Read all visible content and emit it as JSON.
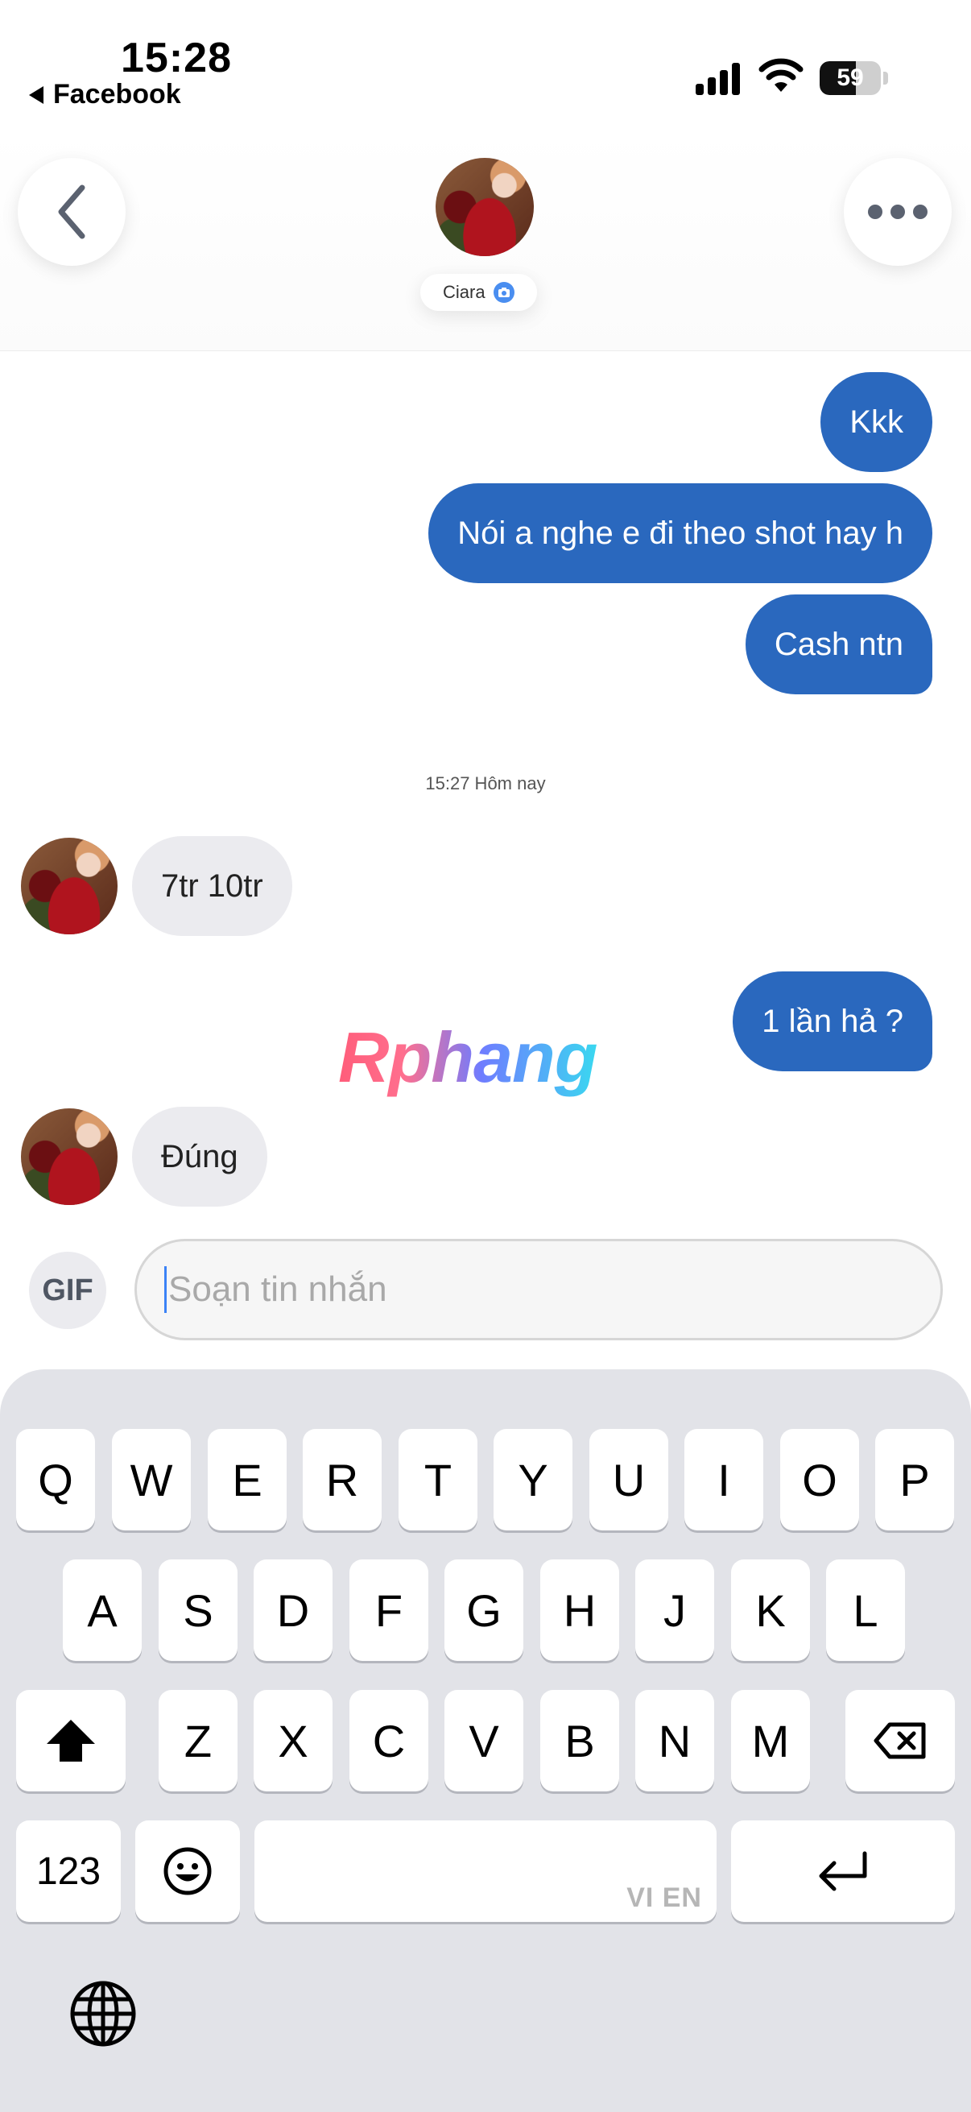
{
  "status_bar": {
    "time": "15:28",
    "back_app": "Facebook",
    "battery": "59",
    "battery_level": 0.59
  },
  "header": {
    "contact_name": "Ciara"
  },
  "messages": [
    {
      "text": "Kkk",
      "direction": "outgoing"
    },
    {
      "text": "Nói a nghe e đi theo shot hay h",
      "direction": "outgoing"
    },
    {
      "text": "Cash ntn",
      "direction": "outgoing"
    },
    {
      "text": "7tr  10tr",
      "direction": "incoming"
    },
    {
      "text": "1 lần hả ?",
      "direction": "outgoing"
    },
    {
      "text": "Đúng",
      "direction": "incoming"
    }
  ],
  "timestamp": "15:27 Hôm nay",
  "watermark": "Rphang",
  "composer": {
    "gif_label": "GIF",
    "placeholder": "Soạn tin nhắn"
  },
  "keyboard": {
    "row1": [
      "Q",
      "W",
      "E",
      "R",
      "T",
      "Y",
      "U",
      "I",
      "O",
      "P"
    ],
    "row2": [
      "A",
      "S",
      "D",
      "F",
      "G",
      "H",
      "J",
      "K",
      "L"
    ],
    "row3": [
      "Z",
      "X",
      "C",
      "V",
      "B",
      "N",
      "M"
    ],
    "numbers_label": "123",
    "space_hint": "VI EN"
  },
  "colors": {
    "outgoing_bubble": "#2a68be",
    "incoming_bubble": "#ebebef",
    "verified": "#4a8ef0"
  }
}
